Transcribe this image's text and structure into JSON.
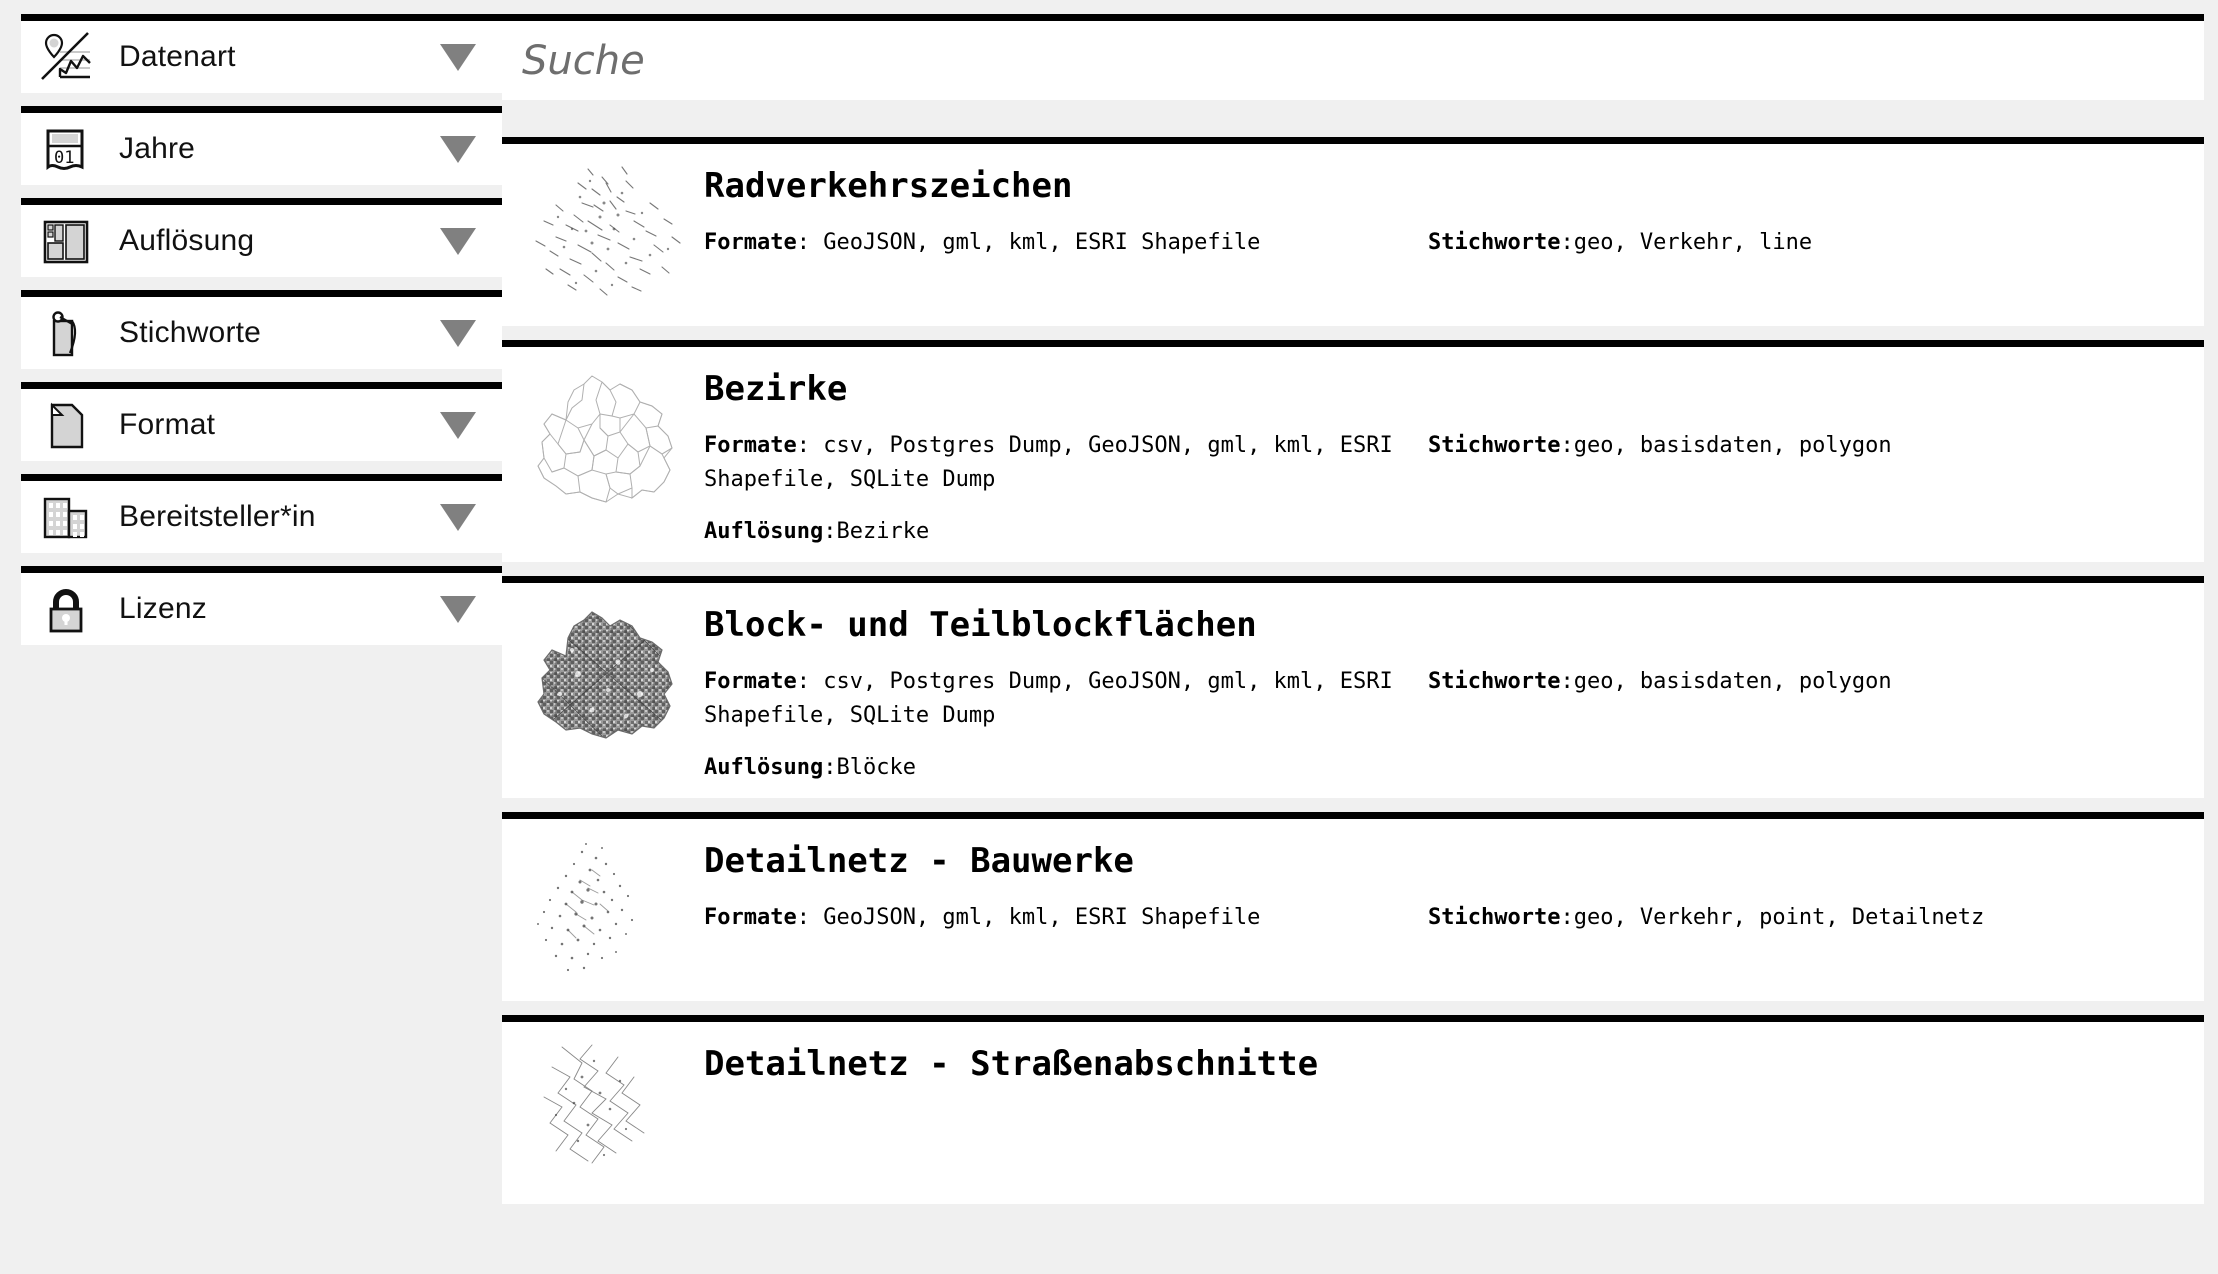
{
  "sidebar": {
    "facets": [
      {
        "label": "Datenart",
        "icon": "map-pin-chart-icon",
        "caret": "chevron-down-icon"
      },
      {
        "label": "Jahre",
        "icon": "calendar-icon",
        "caret": "chevron-down-icon"
      },
      {
        "label": "Auflösung",
        "icon": "grid-layout-icon",
        "caret": "chevron-down-icon"
      },
      {
        "label": "Stichworte",
        "icon": "tag-icon",
        "caret": "chevron-down-icon"
      },
      {
        "label": "Format",
        "icon": "document-icon",
        "caret": "chevron-down-icon"
      },
      {
        "label": "Bereitsteller*in",
        "icon": "building-icon",
        "caret": "chevron-down-icon"
      },
      {
        "label": "Lizenz",
        "icon": "lock-icon",
        "caret": "chevron-down-icon"
      }
    ]
  },
  "search": {
    "placeholder": "Suche",
    "value": ""
  },
  "labels": {
    "formate": "Formate",
    "formate_sep": ": ",
    "stichworte": "Stichworte",
    "stichworte_sep": ":",
    "aufloesung": "Auflösung",
    "aufloesung_sep": ":"
  },
  "results": [
    {
      "title": "Radverkehrszeichen",
      "formats": "GeoJSON, gml, kml, ESRI Shapefile",
      "tags": "geo, Verkehr, line",
      "resolution": "",
      "thumb": "scatter-lines-map-thumbnail"
    },
    {
      "title": "Bezirke",
      "formats": "csv, Postgres Dump, GeoJSON, gml, kml, ESRI Shapefile, SQLite Dump",
      "tags": "geo, basisdaten, polygon",
      "resolution": "Bezirke",
      "thumb": "berlin-districts-outline-thumbnail"
    },
    {
      "title": "Block- und Teilblockflächen",
      "formats": "csv, Postgres Dump, GeoJSON, gml, kml, ESRI Shapefile, SQLite Dump",
      "tags": "geo, basisdaten, polygon",
      "resolution": "Blöcke",
      "thumb": "berlin-blocks-filled-thumbnail"
    },
    {
      "title": "Detailnetz - Bauwerke",
      "formats": "GeoJSON, gml, kml, ESRI Shapefile",
      "tags": "geo, Verkehr, point, Detailnetz",
      "resolution": "",
      "thumb": "scatter-points-map-thumbnail"
    },
    {
      "title": "Detailnetz - Straßenabschnitte",
      "formats": "",
      "tags": "",
      "resolution": "",
      "thumb": "street-network-map-thumbnail"
    }
  ],
  "colors": {
    "background": "#f0f0f0",
    "card": "#ffffff",
    "border": "#000000",
    "caret": "#808080",
    "placeholder": "#6e6e6e",
    "icon_fill": "#d4d4d4"
  }
}
